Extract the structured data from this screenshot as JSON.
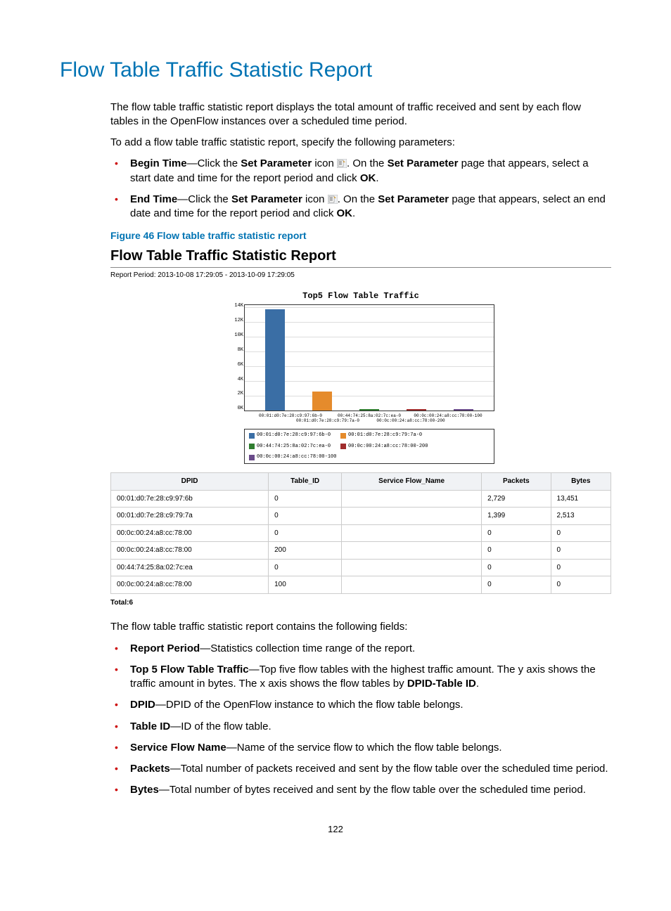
{
  "page_title": "Flow Table Traffic Statistic Report",
  "intro_para": "The flow table traffic statistic report displays the total amount of traffic received and sent by each flow tables in the OpenFlow instances over a scheduled time period.",
  "intro_para2": "To add a flow table traffic statistic report, specify the following parameters:",
  "params": {
    "begin": {
      "label": "Begin Time",
      "pre": "—Click the ",
      "set_param": "Set Parameter",
      "mid": " icon ",
      "post1": ". On the ",
      "post2": " page that appears, select a start date and time for the report period and click ",
      "ok": "OK",
      "end": "."
    },
    "end": {
      "label": "End Time",
      "pre": "—Click the ",
      "set_param": "Set Parameter",
      "mid": " icon ",
      "post1": ". On the ",
      "post2": " page that appears, select an end date and time for the report period and click ",
      "ok": "OK",
      "endtxt": "."
    }
  },
  "figure_caption": "Figure 46 Flow table traffic statistic report",
  "screenshot": {
    "title": "Flow Table Traffic Statistic Report",
    "period": "Report Period: 2013-10-08 17:29:05  -  2013-10-09 17:29:05",
    "total": "Total:6"
  },
  "chart_data": {
    "type": "bar",
    "title": "Top5 Flow Table Traffic",
    "ylabel": "",
    "xlabel": "",
    "ylim": [
      0,
      14000
    ],
    "yticks": [
      "0K",
      "2K",
      "4K",
      "6K",
      "8K",
      "10K",
      "12K",
      "14K"
    ],
    "categories_top": [
      "00:01:d0:7e:28:c9:97:6b-0",
      "00:44:74:25:8a:02:7c:ea-0",
      "00:0c:00:24:a8:cc:78:00-100"
    ],
    "categories_bottom": [
      "00:01:d0:7e:28:c9:79:7a-0",
      "00:0c:00:24:a8:cc:78:00-200"
    ],
    "series": [
      {
        "name": "00:01:d0:7e:28:c9:97:6b-0",
        "value": 13451,
        "color": "#3a6ea5"
      },
      {
        "name": "00:01:d0:7e:28:c9:79:7a-0",
        "value": 2513,
        "color": "#e58b2c"
      },
      {
        "name": "00:44:74:25:8a:02:7c:ea-0",
        "value": 0,
        "color": "#2f7d2f"
      },
      {
        "name": "00:0c:00:24:a8:cc:78:00-200",
        "value": 0,
        "color": "#a02c2c"
      },
      {
        "name": "00:0c:00:24:a8:cc:78:00-100",
        "value": 0,
        "color": "#6a4b8a"
      }
    ]
  },
  "table": {
    "headers": [
      "DPID",
      "Table_ID",
      "Service Flow_Name",
      "Packets",
      "Bytes"
    ],
    "rows": [
      [
        "00:01:d0:7e:28:c9:97:6b",
        "0",
        "",
        "2,729",
        "13,451"
      ],
      [
        "00:01:d0:7e:28:c9:79:7a",
        "0",
        "",
        "1,399",
        "2,513"
      ],
      [
        "00:0c:00:24:a8:cc:78:00",
        "0",
        "",
        "0",
        "0"
      ],
      [
        "00:0c:00:24:a8:cc:78:00",
        "200",
        "",
        "0",
        "0"
      ],
      [
        "00:44:74:25:8a:02:7c:ea",
        "0",
        "",
        "0",
        "0"
      ],
      [
        "00:0c:00:24:a8:cc:78:00",
        "100",
        "",
        "0",
        "0"
      ]
    ]
  },
  "fields_intro": "The flow table traffic statistic report contains the following fields:",
  "fields": [
    {
      "term": "Report Period",
      "desc": "—Statistics collection time range of the report."
    },
    {
      "term": "Top 5 Flow Table Traffic",
      "desc": "—Top five flow tables with the highest traffic amount. The y axis shows the traffic amount in bytes. The x axis shows the flow tables by ",
      "bold2": "DPID-Table ID",
      "desc2": "."
    },
    {
      "term": "DPID",
      "desc": "—DPID of the OpenFlow instance to which the flow table belongs."
    },
    {
      "term": "Table ID",
      "desc": "—ID of the flow table."
    },
    {
      "term": "Service Flow Name",
      "desc": "—Name of the service flow to which the flow table belongs."
    },
    {
      "term": "Packets",
      "desc": "—Total number of packets received and sent by the flow table over the scheduled time period."
    },
    {
      "term": "Bytes",
      "desc": "—Total number of bytes received and sent by the flow table over the scheduled time period."
    }
  ],
  "page_number": "122"
}
